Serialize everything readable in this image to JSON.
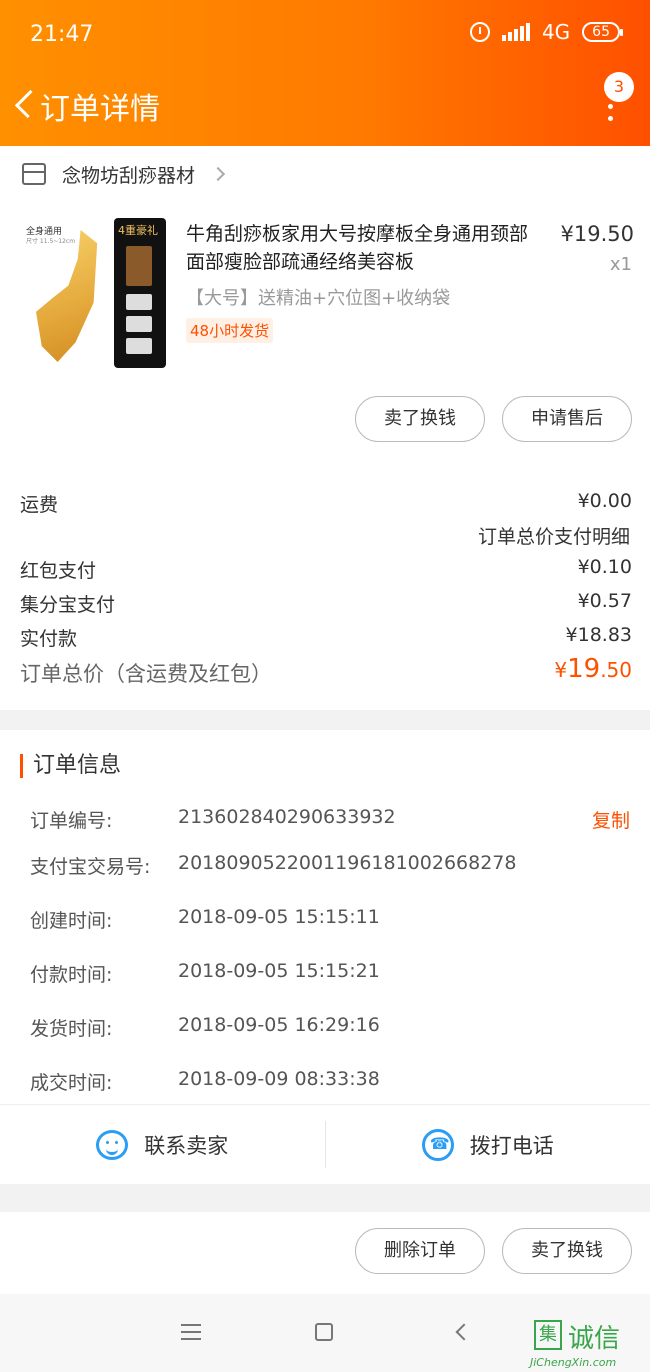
{
  "status_bar": {
    "time": "21:47",
    "network": "4G",
    "battery": "65"
  },
  "header": {
    "title": "订单详情",
    "badge_count": "3"
  },
  "shop": {
    "name": "念物坊刮痧器材"
  },
  "product": {
    "title": "牛角刮痧板家用大号按摩板全身通用颈部面部瘦脸部疏通经络美容板",
    "price": "¥19.50",
    "quantity": "x1",
    "spec": "【大号】送精油+穴位图+收纳袋",
    "shipping_tag": "48小时发货",
    "image_label": "全身通用",
    "image_sub_label": "尺寸 11.5~12cm",
    "image_panel_title": "4重豪礼"
  },
  "product_actions": {
    "resell_label": "卖了换钱",
    "after_sale_label": "申请售后"
  },
  "fees": {
    "shipping_label": "运费",
    "shipping_value": "¥0.00",
    "detail_link": "订单总价支付明细",
    "red_packet_label": "红包支付",
    "red_packet_value": "¥0.10",
    "jifenbao_label": "集分宝支付",
    "jifenbao_value": "¥0.57",
    "paid_label": "实付款",
    "paid_value": "¥18.83",
    "total_label": "订单总价（含运费及红包）",
    "total_currency": "¥",
    "total_int": "19",
    "total_decimal": ".50"
  },
  "order_info": {
    "title": "订单信息",
    "copy_label": "复制",
    "rows": [
      {
        "label": "订单编号:",
        "value": "213602840290633932"
      },
      {
        "label": "支付宝交易号:",
        "value": "2018090522001196181002668278"
      },
      {
        "label": "创建时间:",
        "value": "2018-09-05 15:15:11"
      },
      {
        "label": "付款时间:",
        "value": "2018-09-05 15:15:21"
      },
      {
        "label": "发货时间:",
        "value": "2018-09-05 16:29:16"
      },
      {
        "label": "成交时间:",
        "value": "2018-09-09 08:33:38"
      }
    ]
  },
  "contact": {
    "seller_label": "联系卖家",
    "call_label": "拨打电话"
  },
  "bottom_actions": {
    "delete_label": "删除订单",
    "resell_label": "卖了换钱"
  },
  "watermark": {
    "logo": "集",
    "text": "诚信",
    "url": "JiChengXin.com"
  },
  "colors": {
    "accent": "#ff5000",
    "header_start": "#ff9000",
    "link_blue": "#2a9df4"
  }
}
